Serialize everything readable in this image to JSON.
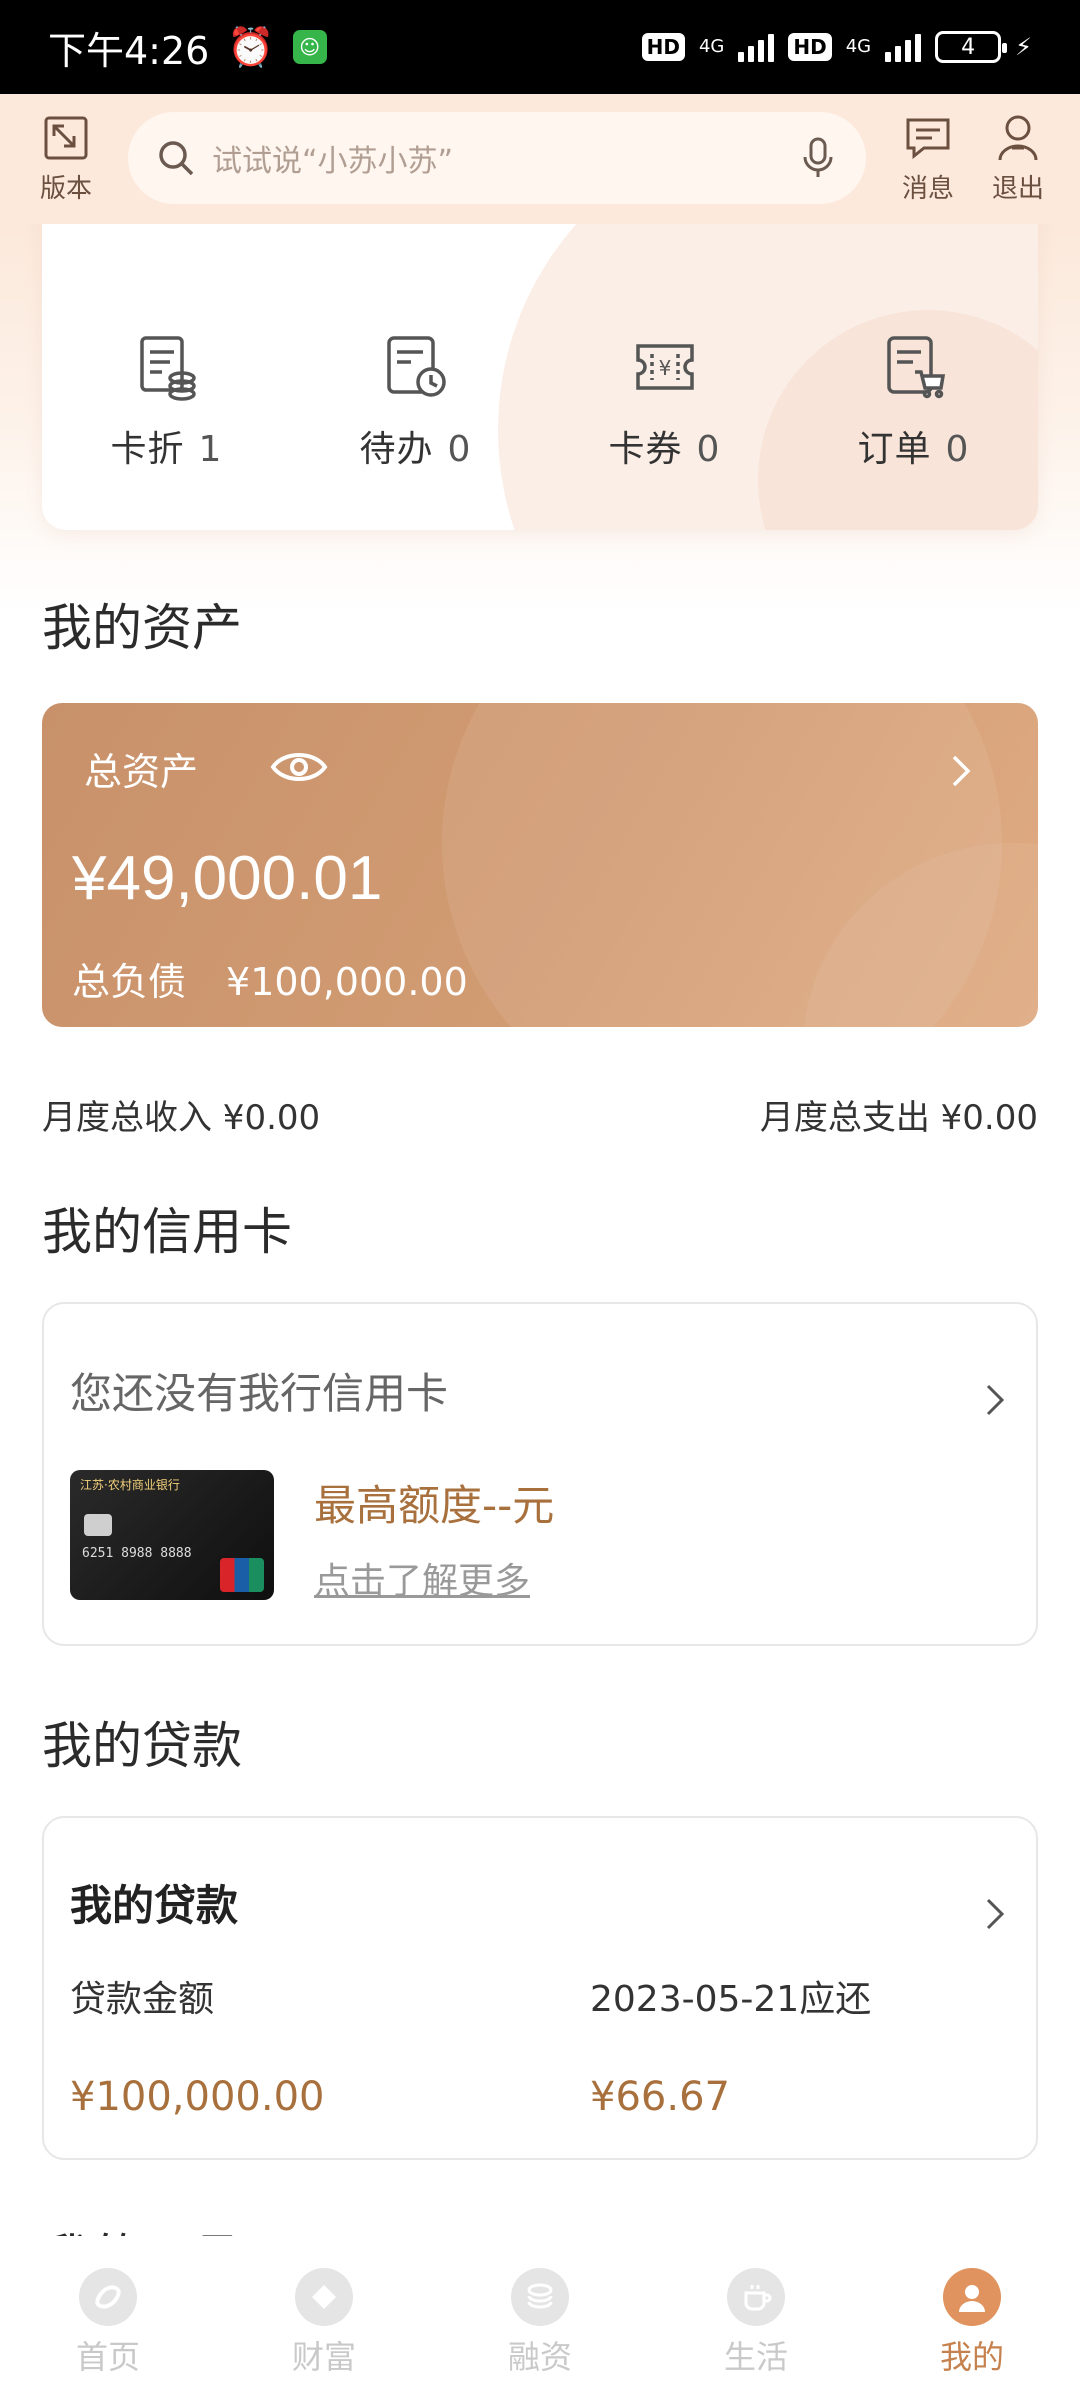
{
  "status_bar": {
    "time": "下午4:26",
    "net1": "4G",
    "net2": "4G",
    "hd": "HD",
    "battery": "4"
  },
  "header": {
    "left_label": "版本",
    "search_placeholder": "试试说“小苏小苏”",
    "message_label": "消息",
    "exit_label": "退出"
  },
  "quick_items": [
    {
      "label": "卡折",
      "count": "1"
    },
    {
      "label": "待办",
      "count": "0"
    },
    {
      "label": "卡券",
      "count": "0"
    },
    {
      "label": "订单",
      "count": "0"
    }
  ],
  "assets": {
    "section_title": "我的资产",
    "total_label": "总资产",
    "total_value": "¥49,000.01",
    "debt_label": "总负债",
    "debt_value": "¥100,000.00",
    "monthly_income": "月度总收入 ¥0.00",
    "monthly_expense": "月度总支出 ¥0.00"
  },
  "credit_card": {
    "section_title": "我的信用卡",
    "no_card_text": "您还没有我行信用卡",
    "limit_text": "最高额度--元",
    "learn_more": "点击了解更多"
  },
  "loan": {
    "section_title": "我的贷款",
    "card_title": "我的贷款",
    "amount_label": "贷款金额",
    "due_label": "2023-05-21应还",
    "amount_value": "¥100,000.00",
    "due_value": "¥66.67"
  },
  "next_section_title": "我的工具",
  "bottom_nav": [
    {
      "label": "首页",
      "icon": "home-icon",
      "active": false
    },
    {
      "label": "财富",
      "icon": "wealth-icon",
      "active": false
    },
    {
      "label": "融资",
      "icon": "finance-icon",
      "active": false
    },
    {
      "label": "生活",
      "icon": "life-icon",
      "active": false
    },
    {
      "label": "我的",
      "icon": "profile-icon",
      "active": true
    }
  ],
  "colors": {
    "accent": "#c6824e",
    "asset_card": "#d29c73",
    "gold_text": "#a8703c",
    "header_bg": "#fde9dc"
  }
}
